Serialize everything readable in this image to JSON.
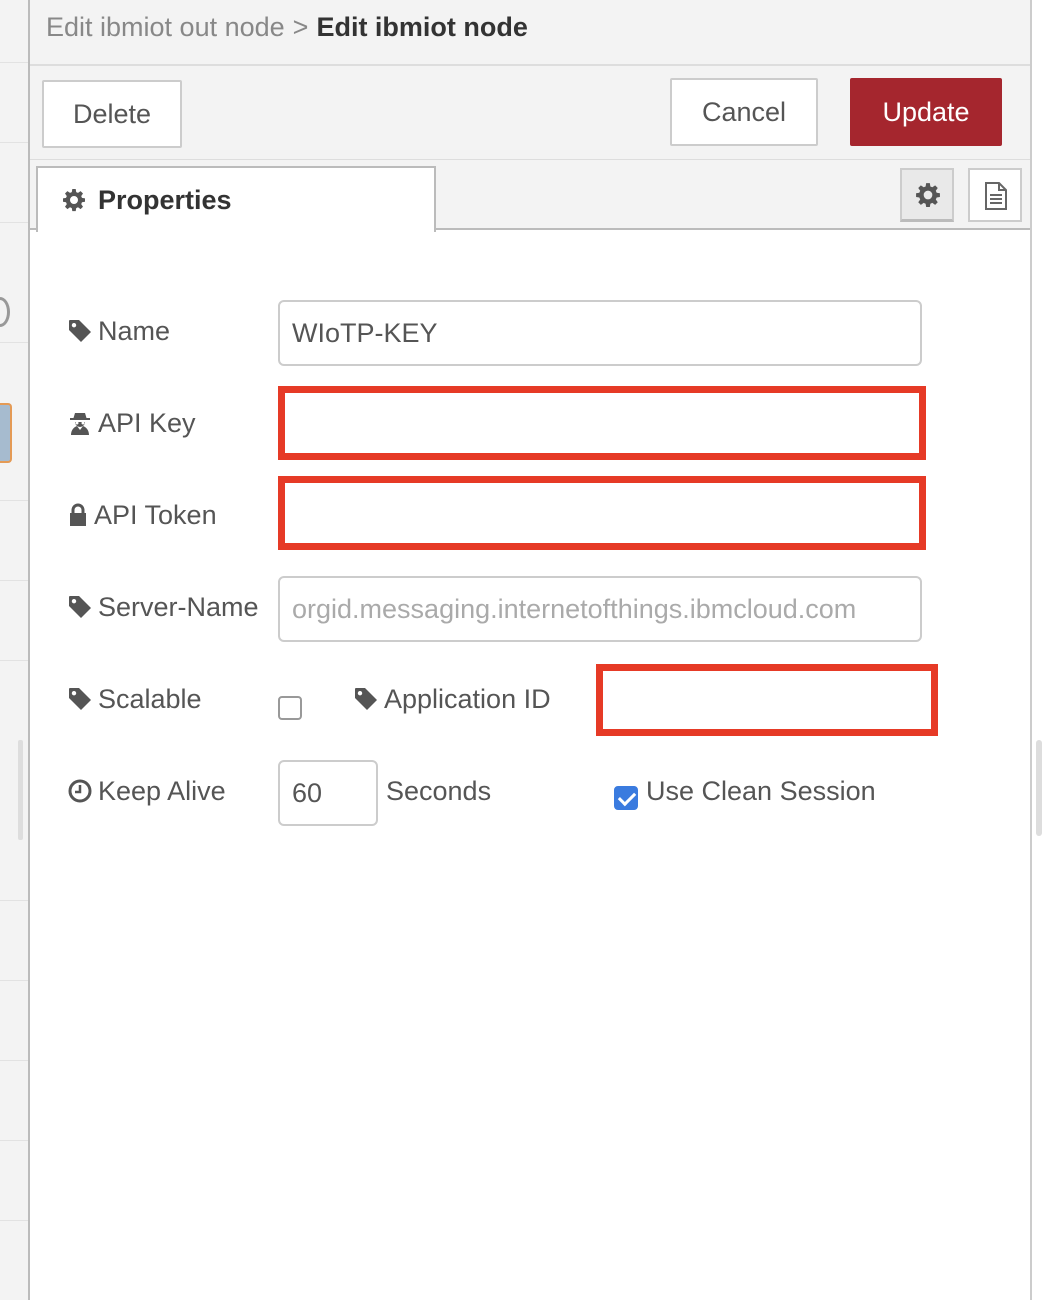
{
  "breadcrumb": {
    "parent": "Edit ibmiot out node",
    "separator": ">",
    "current": "Edit ibmiot node"
  },
  "buttons": {
    "delete": "Delete",
    "cancel": "Cancel",
    "update": "Update"
  },
  "tabs": {
    "properties": "Properties"
  },
  "form": {
    "name": {
      "label": "Name",
      "value": "WIoTP-KEY"
    },
    "api_key": {
      "label": "API Key",
      "value": ""
    },
    "api_token": {
      "label": "API Token",
      "value": ""
    },
    "server_name": {
      "label": "Server-Name",
      "value": "",
      "placeholder": "orgid.messaging.internetofthings.ibmcloud.com"
    },
    "scalable": {
      "label": "Scalable",
      "checked": false
    },
    "application_id": {
      "label": "Application ID",
      "value": ""
    },
    "keep_alive": {
      "label": "Keep Alive",
      "value": "60",
      "unit": "Seconds"
    },
    "clean_session": {
      "label": "Use Clean Session",
      "checked": true
    }
  },
  "colors": {
    "update_button": "#a5262e",
    "highlight_box": "#e63a26",
    "checkbox_checked": "#3a7bdf"
  },
  "icons": {
    "tab_properties": "gear-icon",
    "tab_settings": "gear-icon",
    "tab_info": "document-icon",
    "name": "tag-icon",
    "api_key": "user-secret-icon",
    "api_token": "lock-icon",
    "server_name": "tag-icon",
    "scalable": "tag-icon",
    "application_id": "tag-icon",
    "keep_alive": "clock-icon"
  }
}
